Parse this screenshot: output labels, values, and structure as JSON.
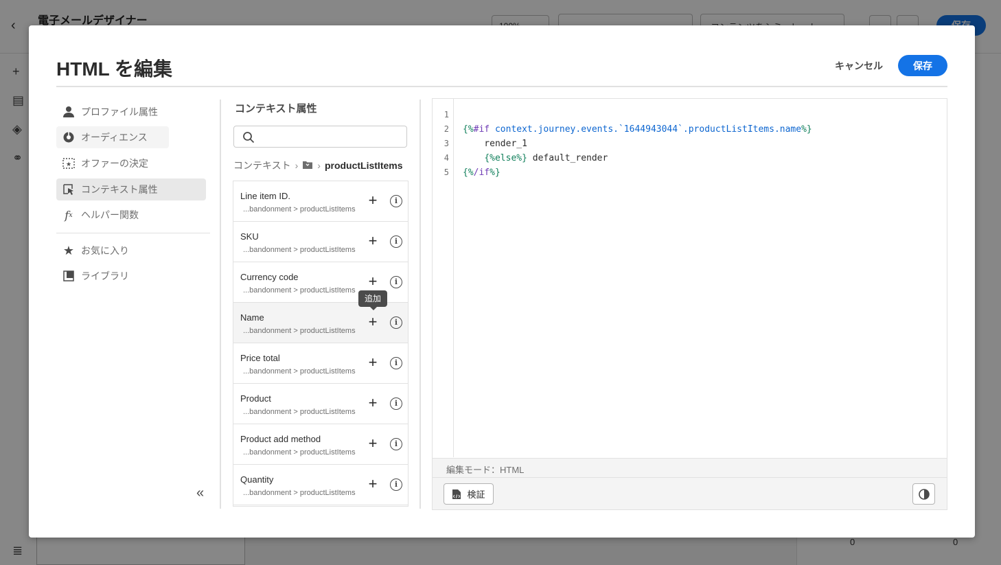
{
  "background": {
    "title": "電子メールデザイナー",
    "zoom": "100%",
    "simulate": "コンテンツをシミュレート",
    "save": "保存",
    "padding_top": "0",
    "padding_bottom": "0"
  },
  "modal": {
    "title": "HTML を編集",
    "cancel_label": "キャンセル",
    "save_label": "保存",
    "accent_color": "#1473e6"
  },
  "nav": {
    "items": [
      {
        "label": "プロファイル属性",
        "icon": "user-icon"
      },
      {
        "label": "オーディエンス",
        "icon": "audience-icon"
      },
      {
        "label": "オファーの決定",
        "icon": "offer-decision-icon"
      },
      {
        "label": "コンテキスト属性",
        "icon": "context-attribute-icon"
      },
      {
        "label": "ヘルパー関数",
        "icon": "function-icon"
      },
      {
        "label": "お気に入り",
        "icon": "star-icon"
      },
      {
        "label": "ライブラリ",
        "icon": "library-icon"
      }
    ],
    "active_index": 3
  },
  "context_panel": {
    "title": "コンテキスト属性",
    "search_placeholder": "",
    "breadcrumb": {
      "root": "コンテキスト",
      "current": "productListItems"
    },
    "items": [
      {
        "label": "Line item ID.",
        "path": "...bandonment > productListItems"
      },
      {
        "label": "SKU",
        "path": "...bandonment > productListItems"
      },
      {
        "label": "Currency code",
        "path": "...bandonment > productListItems"
      },
      {
        "label": "Name",
        "path": "...bandonment > productListItems"
      },
      {
        "label": "Price total",
        "path": "...bandonment > productListItems"
      },
      {
        "label": "Product",
        "path": "...bandonment > productListItems"
      },
      {
        "label": "Product add method",
        "path": "...bandonment > productListItems"
      },
      {
        "label": "Quantity",
        "path": "...bandonment > productListItems"
      }
    ],
    "tooltip": "追加"
  },
  "editor": {
    "line_numbers": [
      "1",
      "2",
      "3",
      "4",
      "5"
    ],
    "code": {
      "l2_open": "{%",
      "l2_kw": "#if",
      "l2_expr": " context.journey.events.`1644943044`.productListItems.name",
      "l2_close": "%}",
      "l3": "    render_1",
      "l4_open": "{%",
      "l4_kw": "else",
      "l4_close": "%}",
      "l4_rest": " default_render",
      "l5_open": "{%",
      "l5_kw": "/if",
      "l5_close": "%}"
    },
    "mode_label": "編集モード：HTML",
    "validate_label": "検証"
  }
}
